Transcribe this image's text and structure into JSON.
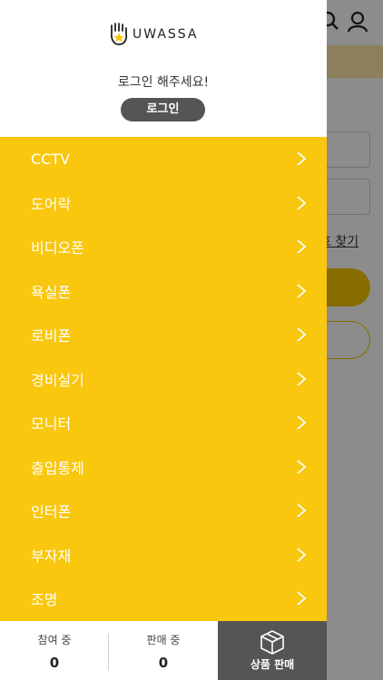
{
  "background": {
    "find_link": "호 찾기"
  },
  "drawer": {
    "logo_text": "UWASSA",
    "login_message": "로그인 해주세요!",
    "login_button": "로그인",
    "menu": [
      {
        "label": "CCTV"
      },
      {
        "label": "도어락"
      },
      {
        "label": "비디오폰"
      },
      {
        "label": "욕실폰"
      },
      {
        "label": "로비폰"
      },
      {
        "label": "경비실기"
      },
      {
        "label": "모니터"
      },
      {
        "label": "출입통제"
      },
      {
        "label": "인터폰"
      },
      {
        "label": "부자재"
      },
      {
        "label": "조명"
      }
    ],
    "stats": {
      "participating_label": "참여 중",
      "participating_value": "0",
      "selling_label": "판매 중",
      "selling_value": "0"
    },
    "sell_button": "상품 판매"
  },
  "colors": {
    "menu_bg": "#f8c70e",
    "accent": "#f6c500",
    "dark_button": "#555555"
  },
  "icons": [
    "close-icon",
    "search-icon",
    "user-icon",
    "hand-logo-icon",
    "chevron-right-icon",
    "box-icon"
  ]
}
